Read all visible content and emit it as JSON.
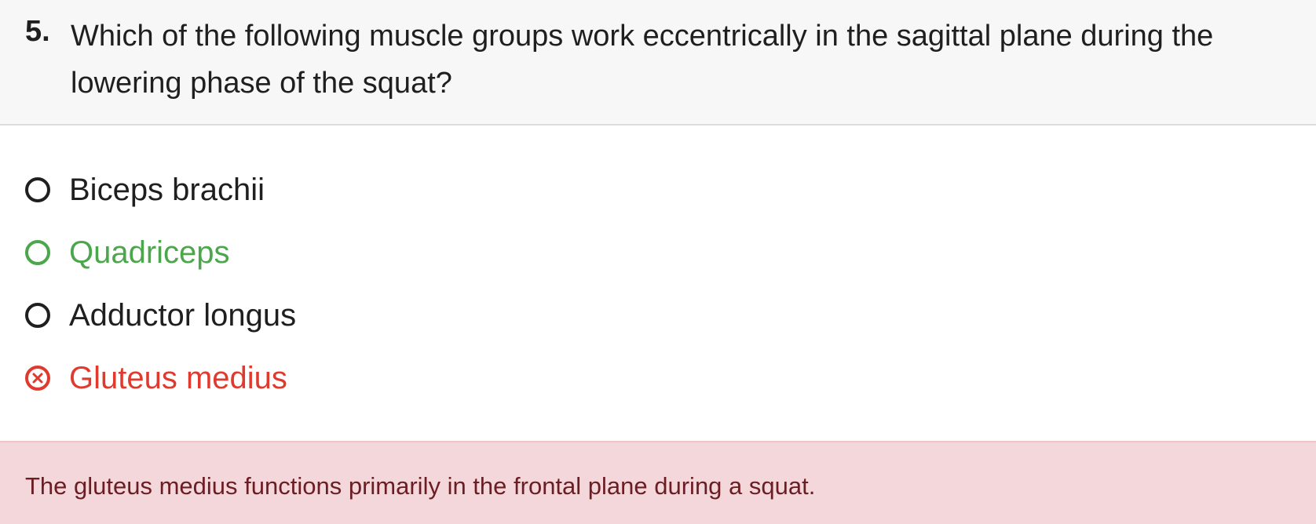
{
  "question": {
    "number": "5.",
    "text": "Which of the following muscle groups work eccentrically in the sagittal plane during the lowering phase of the squat?"
  },
  "options": [
    {
      "label": "Biceps brachii",
      "state": "neutral",
      "color": "#1f1f1f"
    },
    {
      "label": "Quadriceps",
      "state": "correct",
      "color": "#4ca64c"
    },
    {
      "label": "Adductor longus",
      "state": "neutral",
      "color": "#1f1f1f"
    },
    {
      "label": "Gluteus medius",
      "state": "incorrect-selected",
      "color": "#e03a2f"
    }
  ],
  "feedback": {
    "text": "The gluteus medius functions primarily in the frontal plane during a squat.",
    "background_color": "#f4d7da",
    "text_color": "#6b1d24"
  },
  "icons": {
    "incorrect": "x-circle-icon",
    "radio": "radio-circle-icon"
  }
}
